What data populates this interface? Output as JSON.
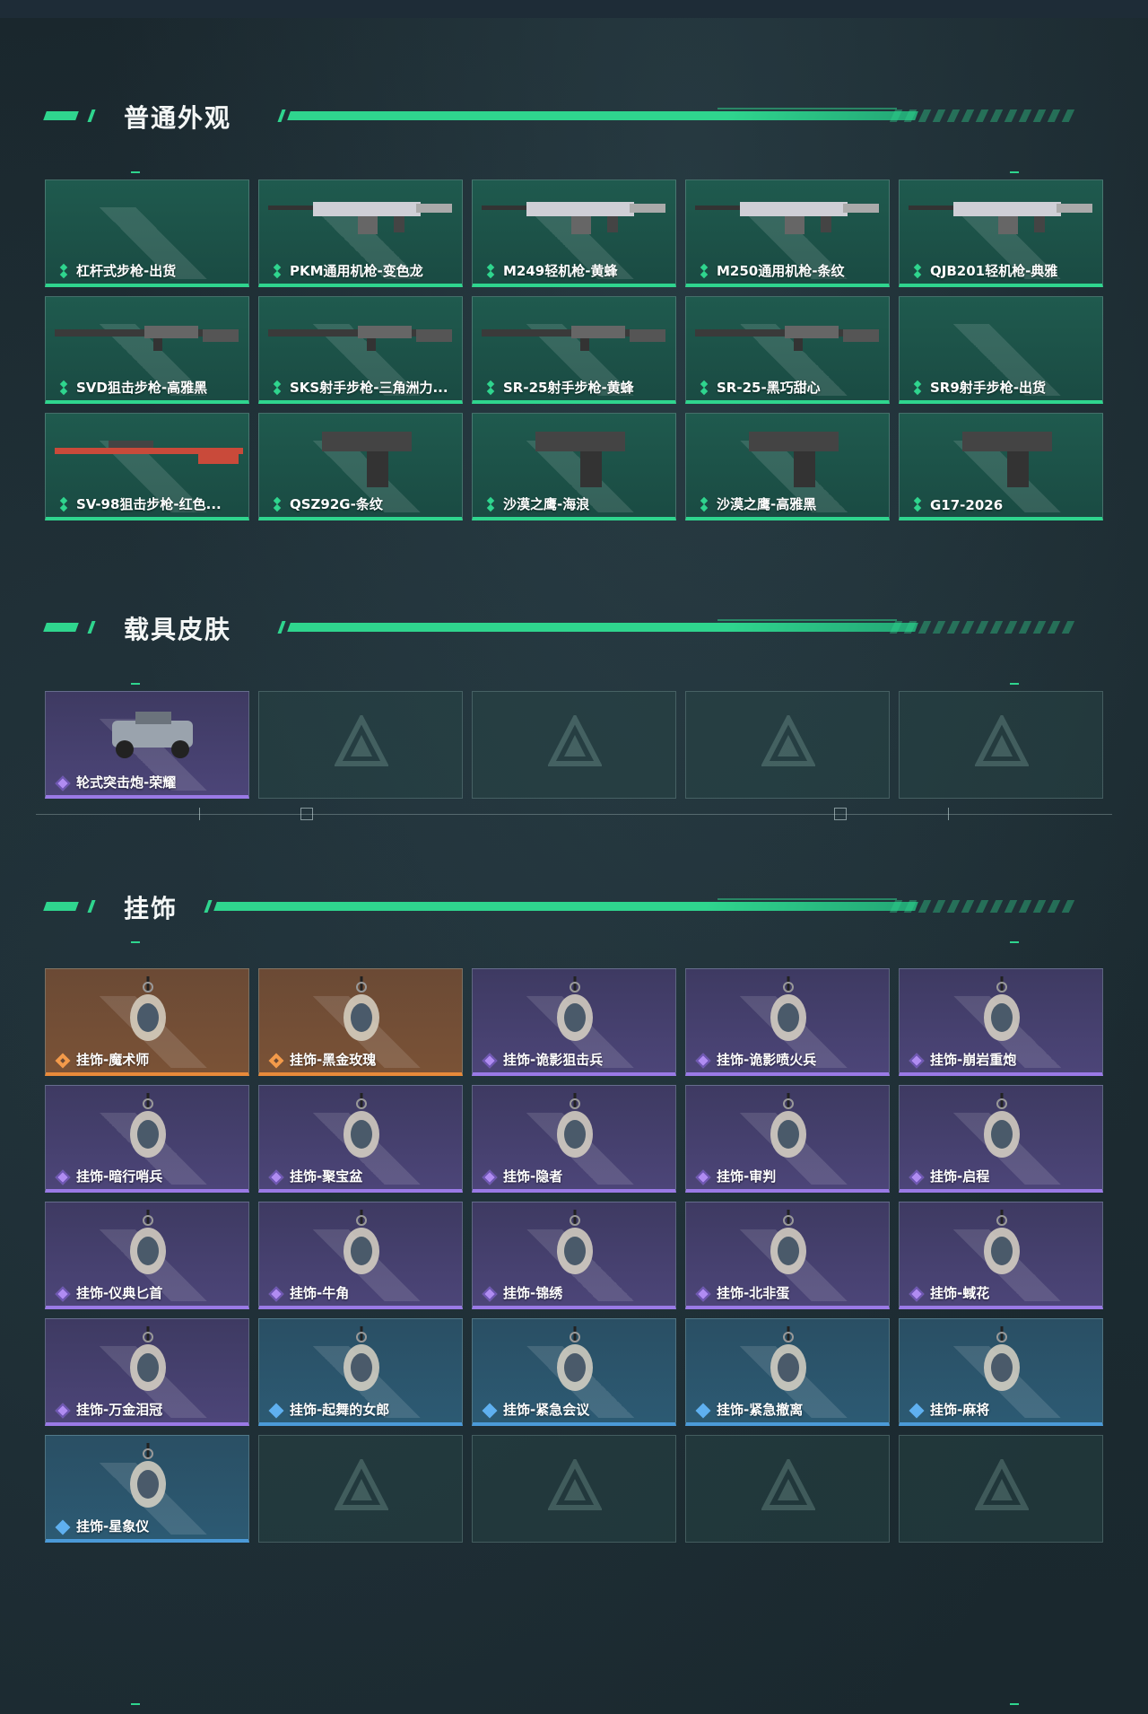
{
  "sections": {
    "weapons": {
      "title": "普通外观",
      "items": [
        {
          "label": "杠杆式步枪-出货",
          "rarity": "green",
          "image": "none"
        },
        {
          "label": "PKM通用机枪-变色龙",
          "rarity": "green",
          "image": "machine-gun-icon"
        },
        {
          "label": "M249轻机枪-黄蜂",
          "rarity": "green",
          "image": "machine-gun-icon"
        },
        {
          "label": "M250通用机枪-条纹",
          "rarity": "green",
          "image": "machine-gun-icon"
        },
        {
          "label": "QJB201轻机枪-典雅",
          "rarity": "green",
          "image": "machine-gun-icon"
        },
        {
          "label": "SVD狙击步枪-高雅黑",
          "rarity": "green",
          "image": "rifle-icon"
        },
        {
          "label": "SKS射手步枪-三角洲力...",
          "rarity": "green",
          "image": "rifle-icon"
        },
        {
          "label": "SR-25射手步枪-黄蜂",
          "rarity": "green",
          "image": "rifle-icon"
        },
        {
          "label": "SR-25-黑巧甜心",
          "rarity": "green",
          "image": "rifle-icon"
        },
        {
          "label": "SR9射手步枪-出货",
          "rarity": "green",
          "image": "none"
        },
        {
          "label": "SV-98狙击步枪-红色...",
          "rarity": "green",
          "image": "sniper-icon"
        },
        {
          "label": "QSZ92G-条纹",
          "rarity": "green",
          "image": "pistol-icon"
        },
        {
          "label": "沙漠之鹰-海浪",
          "rarity": "green",
          "image": "pistol-icon"
        },
        {
          "label": "沙漠之鹰-高雅黑",
          "rarity": "green",
          "image": "pistol-icon"
        },
        {
          "label": "G17-2026",
          "rarity": "green",
          "image": "pistol-icon"
        }
      ]
    },
    "vehicles": {
      "title": "载具皮肤",
      "items": [
        {
          "label": "轮式突击炮-荣耀",
          "rarity": "purple",
          "image": "vehicle-icon"
        }
      ]
    },
    "charms": {
      "title": "挂饰",
      "items": [
        {
          "label": "挂饰-魔术师",
          "rarity": "orange"
        },
        {
          "label": "挂饰-黑金玫瑰",
          "rarity": "orange"
        },
        {
          "label": "挂饰-诡影狙击兵",
          "rarity": "purple"
        },
        {
          "label": "挂饰-诡影喷火兵",
          "rarity": "purple"
        },
        {
          "label": "挂饰-崩岩重炮",
          "rarity": "purple"
        },
        {
          "label": "挂饰-暗行哨兵",
          "rarity": "purple"
        },
        {
          "label": "挂饰-聚宝盆",
          "rarity": "purple"
        },
        {
          "label": "挂饰-隐者",
          "rarity": "purple"
        },
        {
          "label": "挂饰-审判",
          "rarity": "purple"
        },
        {
          "label": "挂饰-启程",
          "rarity": "purple"
        },
        {
          "label": "挂饰-仪典匕首",
          "rarity": "purple"
        },
        {
          "label": "挂饰-牛角",
          "rarity": "purple"
        },
        {
          "label": "挂饰-锦绣",
          "rarity": "purple"
        },
        {
          "label": "挂饰-北非蛋",
          "rarity": "purple"
        },
        {
          "label": "挂饰-蜮花",
          "rarity": "purple"
        },
        {
          "label": "挂饰-万金泪冠",
          "rarity": "purple"
        },
        {
          "label": "挂饰-起舞的女郎",
          "rarity": "blue"
        },
        {
          "label": "挂饰-紧急会议",
          "rarity": "blue"
        },
        {
          "label": "挂饰-紧急撤离",
          "rarity": "blue"
        },
        {
          "label": "挂饰-麻将",
          "rarity": "blue"
        },
        {
          "label": "挂饰-星象仪",
          "rarity": "blue"
        }
      ]
    }
  },
  "colors": {
    "accent": "#2fd58e",
    "green": "#2fd58e",
    "purple": "#9a7ae6",
    "orange": "#e88a3a",
    "blue": "#4b9ad8"
  }
}
